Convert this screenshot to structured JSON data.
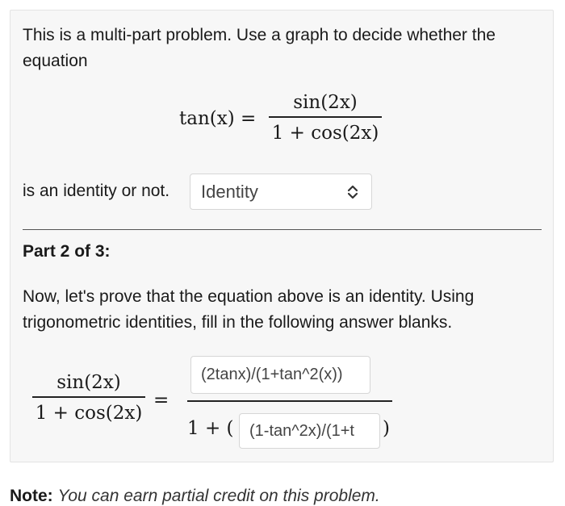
{
  "part1": {
    "intro_line1": "This is a multi-part problem. Use a graph to decide whether the",
    "intro_line2": "equation",
    "eq_lhs": "tan(x) =",
    "eq_num": "sin(2x)",
    "eq_den": "1 + cos(2x)",
    "identity_prefix": "is an identity or not.",
    "select_value": "Identity"
  },
  "part2": {
    "heading": "Part 2 of 3:",
    "text_line1": "Now, let's prove that the equation above is an identity. Using",
    "text_line2": "trigonometric identities, fill in the following answer blanks.",
    "lhs_num": "sin(2x)",
    "lhs_den": "1 + cos(2x)",
    "equals": "=",
    "rhs_den_prefix": "1 + (",
    "rhs_den_suffix": ")",
    "answer1_value": "(2tanx)/(1+tan^2(x))",
    "answer2_value": "(1-tan^2x)/(1+t"
  },
  "note": {
    "label": "Note:",
    "text": "You can earn partial credit on this problem."
  }
}
